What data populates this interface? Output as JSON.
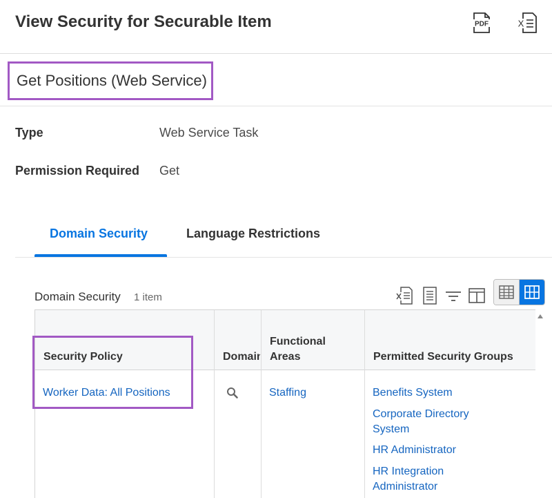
{
  "header": {
    "title": "View Security for Securable Item",
    "pdf_icon_text": "PDF",
    "export_icon_text": "X"
  },
  "item": {
    "title": "Get Positions (Web Service)"
  },
  "fields": [
    {
      "label": "Type",
      "value": "Web Service Task"
    },
    {
      "label": "Permission Required",
      "value": "Get"
    }
  ],
  "tabs": [
    {
      "label": "Domain Security",
      "active": true
    },
    {
      "label": "Language Restrictions",
      "active": false
    }
  ],
  "grid": {
    "title": "Domain Security",
    "count": "1 item",
    "columns": [
      {
        "line1": "Security Policy"
      },
      {
        "line1": "Domain"
      },
      {
        "line1": "Functional",
        "line2": "Areas"
      },
      {
        "line1": "Permitted Security Groups"
      }
    ],
    "row": {
      "security_policy": "Worker Data: All Positions",
      "functional_area": "Staffing",
      "groups": [
        {
          "line1": "Benefits System"
        },
        {
          "line1": "Corporate Directory",
          "line2": "System"
        },
        {
          "line1": "HR Administrator"
        },
        {
          "line1": "HR Integration",
          "line2": "Administrator"
        }
      ]
    }
  },
  "colors": {
    "accent": "#0875e1",
    "link": "#1565c0",
    "highlight": "#a259c4"
  }
}
